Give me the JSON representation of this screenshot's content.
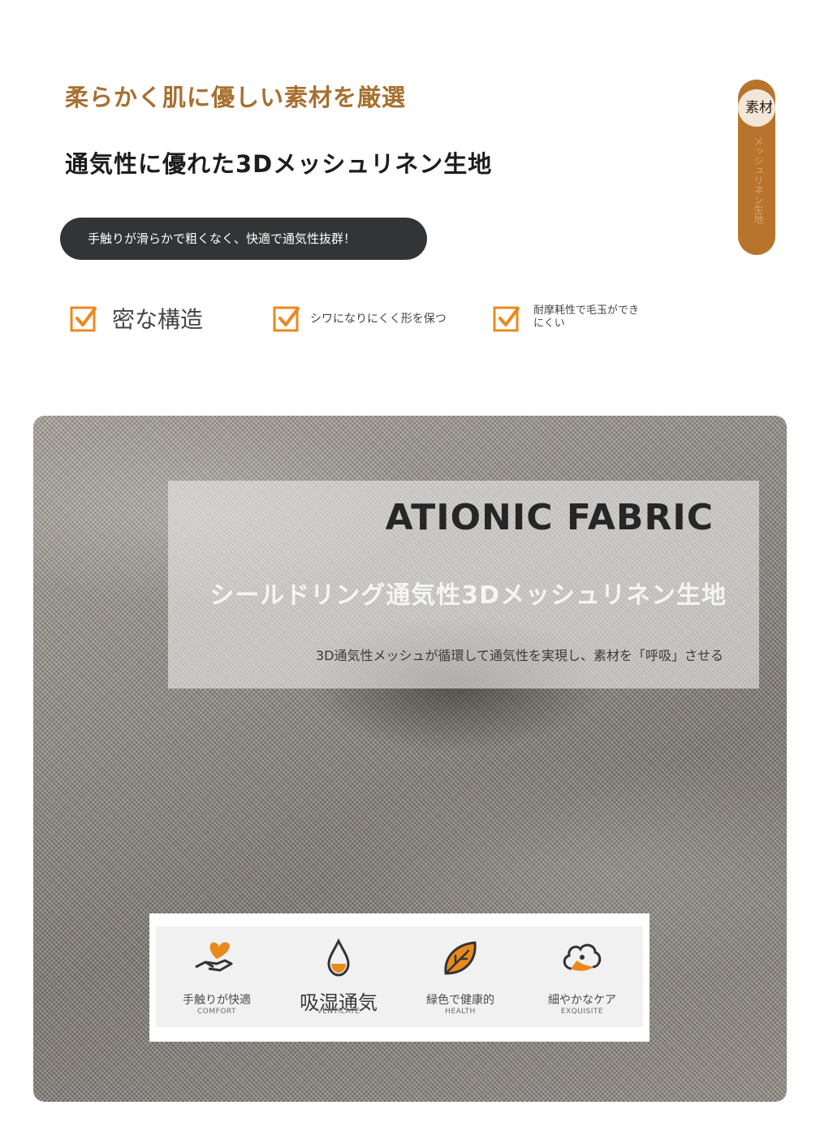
{
  "header": {
    "title_orange": "柔らかく肌に優しい素材を厳選",
    "title_black": "通気性に優れた3Dメッシュリネン生地",
    "pill_text": "手触りが滑らかで粗くなく、快適で通気性抜群！"
  },
  "side_tab": {
    "label": "素材",
    "vertical_text": "メッシュリネン生地"
  },
  "features": [
    {
      "text": "密な構造",
      "icon": "checkbox-icon"
    },
    {
      "text": "シワになりにくく形を保つ",
      "icon": "checkbox-icon"
    },
    {
      "text": "耐摩耗性で毛玉ができにくい",
      "icon": "checkbox-icon"
    }
  ],
  "fabric": {
    "title_en": "ATIONIC FABRIC",
    "title_jp": "シールドリング通気性3Dメッシュリネン生地",
    "description": "3D通気性メッシュが循環して通気性を実現し、素材を「呼吸」させる"
  },
  "badges": [
    {
      "label": "手触りが快適",
      "sub": "COMFORT",
      "icon": "hand-heart-icon"
    },
    {
      "label": "吸湿通気",
      "sub": "VENTILATE",
      "icon": "water-drop-icon"
    },
    {
      "label": "緑色で健康的",
      "sub": "HEALTH",
      "icon": "leaf-icon"
    },
    {
      "label": "細やかなケア",
      "sub": "EXQUISITE",
      "icon": "cotton-icon"
    }
  ],
  "colors": {
    "accent_orange": "#e98a1f",
    "brown": "#b8742c",
    "pill_dark": "#333435"
  }
}
